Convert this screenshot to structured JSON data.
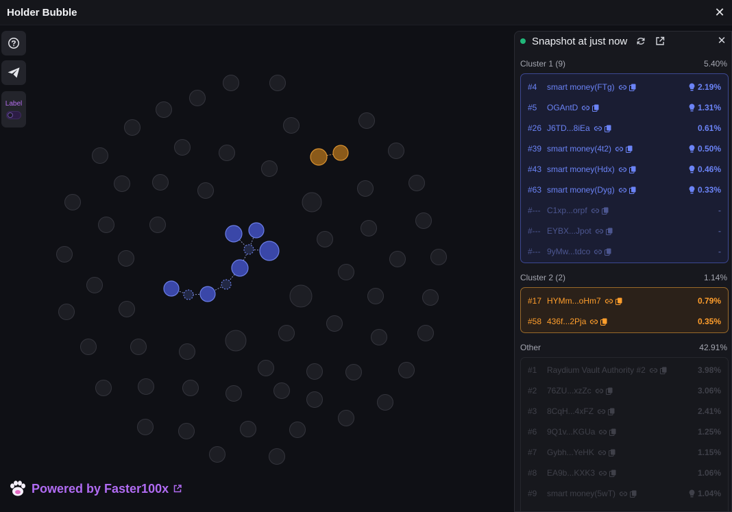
{
  "window": {
    "title": "Holder Bubble",
    "close_icon": "close-icon"
  },
  "toolbar": {
    "help_icon": "help-circle-icon",
    "send_icon": "telegram-send-icon",
    "label_text": "Label",
    "label_toggle_on": false
  },
  "footer": {
    "powered_prefix": "Powered by ",
    "powered_brand": "Faster100x",
    "icon": "external-link-icon"
  },
  "colors": {
    "cluster1": "#6b83f6",
    "cluster2": "#ff9e2c",
    "neutral": "#2a2b31",
    "accent": "#b06bf2",
    "status": "#21b77a"
  },
  "panel": {
    "snapshot_label": "Snapshot at just now",
    "refresh_icon": "refresh-icon",
    "open_icon": "external-link-icon",
    "close_icon": "close-icon",
    "cluster1": {
      "label": "Cluster 1 (9)",
      "total": "5.40%",
      "rows": [
        {
          "rank": "#4",
          "name": "smart money(FTg)",
          "pct": "2.19%",
          "bulb": true,
          "dim": false
        },
        {
          "rank": "#5",
          "name": "OGAntD",
          "pct": "1.31%",
          "bulb": true,
          "dim": false
        },
        {
          "rank": "#26",
          "name": "J6TD...8iEa",
          "pct": "0.61%",
          "bulb": false,
          "dim": false
        },
        {
          "rank": "#39",
          "name": "smart money(4t2)",
          "pct": "0.50%",
          "bulb": true,
          "dim": false
        },
        {
          "rank": "#43",
          "name": "smart money(Hdx)",
          "pct": "0.46%",
          "bulb": true,
          "dim": false
        },
        {
          "rank": "#63",
          "name": "smart money(Dyg)",
          "pct": "0.33%",
          "bulb": true,
          "dim": false
        },
        {
          "rank": "#---",
          "name": "C1xp...orpf",
          "pct": "-",
          "bulb": false,
          "dim": true
        },
        {
          "rank": "#---",
          "name": "EYBX...Jpot",
          "pct": "-",
          "bulb": false,
          "dim": true
        },
        {
          "rank": "#---",
          "name": "9yMw...tdco",
          "pct": "-",
          "bulb": false,
          "dim": true
        }
      ]
    },
    "cluster2": {
      "label": "Cluster 2 (2)",
      "total": "1.14%",
      "rows": [
        {
          "rank": "#17",
          "name": "HYMm...oHm7",
          "pct": "0.79%",
          "bulb": false
        },
        {
          "rank": "#58",
          "name": "436f...2Pja",
          "pct": "0.35%",
          "bulb": false
        }
      ]
    },
    "other": {
      "label": "Other",
      "total": "42.91%",
      "rows": [
        {
          "rank": "#1",
          "name": "Raydium Vault Authority #2",
          "pct": "3.98%",
          "bulb": false
        },
        {
          "rank": "#2",
          "name": "76ZU...xzZc",
          "pct": "3.06%",
          "bulb": false
        },
        {
          "rank": "#3",
          "name": "8CqH...4xFZ",
          "pct": "2.41%",
          "bulb": false
        },
        {
          "rank": "#6",
          "name": "9Q1v...KGUa",
          "pct": "1.25%",
          "bulb": false
        },
        {
          "rank": "#7",
          "name": "Gybh...YeHK",
          "pct": "1.15%",
          "bulb": false
        },
        {
          "rank": "#8",
          "name": "EA9b...KXK3",
          "pct": "1.06%",
          "bulb": false
        },
        {
          "rank": "#9",
          "name": "smart money(5wT)",
          "pct": "1.04%",
          "bulb": true
        }
      ]
    }
  }
}
